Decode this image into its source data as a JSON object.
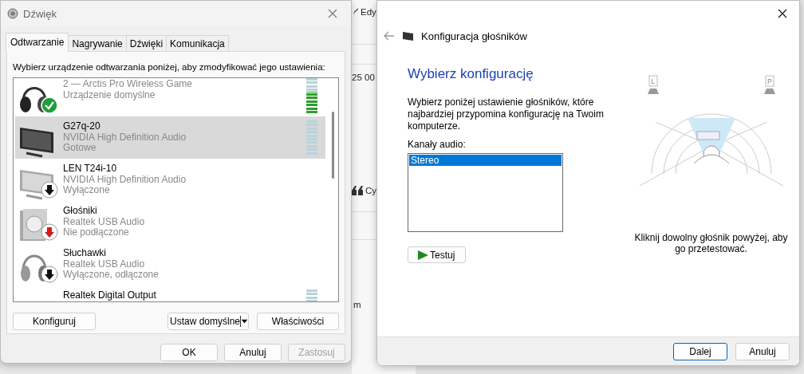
{
  "background_app": {
    "texts": [
      "Edy",
      "25 00",
      "Cy",
      "m"
    ]
  },
  "sound_window": {
    "title": "Dźwięk",
    "tabs": [
      {
        "label": "Odtwarzanie",
        "selected": true
      },
      {
        "label": "Nagrywanie",
        "selected": false
      },
      {
        "label": "Dźwięki",
        "selected": false
      },
      {
        "label": "Komunikacja",
        "selected": false
      }
    ],
    "instruction": "Wybierz urządzenie odtwarzania poniżej, aby zmodyfikować jego ustawienia:",
    "devices": [
      {
        "name": "2 — Arctis Pro Wireless Game",
        "driver": "Urządzenie domyślne",
        "kind": "headset",
        "is_default": true,
        "disabled": false,
        "unplugged": false,
        "selected": false,
        "dimmed": true,
        "meter": true,
        "level": 0.6
      },
      {
        "name": "G27q-20",
        "driver": "NVIDIA High Definition Audio",
        "status": "Gotowe",
        "kind": "monitor",
        "is_default": false,
        "disabled": false,
        "unplugged": false,
        "selected": true,
        "dimmed": false,
        "meter": true,
        "level": 0
      },
      {
        "name": "LEN T24i-10",
        "driver": "NVIDIA High Definition Audio",
        "status": "Wyłączone",
        "kind": "monitor-light",
        "is_default": false,
        "disabled": true,
        "unplugged": false,
        "selected": false,
        "dimmed": false,
        "meter": false
      },
      {
        "name": "Głośniki",
        "driver": "Realtek USB Audio",
        "status": "Nie podłączone",
        "kind": "speaker",
        "is_default": false,
        "disabled": false,
        "unplugged": true,
        "selected": false,
        "dimmed": false,
        "meter": false
      },
      {
        "name": "Słuchawki",
        "driver": "Realtek USB Audio",
        "status": "Wyłączone, odłączone",
        "kind": "headphones",
        "is_default": false,
        "disabled": true,
        "unplugged": false,
        "selected": false,
        "dimmed": false,
        "meter": false
      },
      {
        "name": "Realtek Digital Output",
        "kind": "receiver",
        "is_default": false,
        "disabled": false,
        "unplugged": false,
        "selected": false,
        "dimmed": false,
        "meter": true,
        "level": 0
      }
    ],
    "configure_button": "Konfiguruj",
    "set_default_button": "Ustaw domyślne",
    "properties_button": "Właściwości",
    "footer_buttons": [
      {
        "label": "OK",
        "disabled": false
      },
      {
        "label": "Anuluj",
        "disabled": false
      },
      {
        "label": "Zastosuj",
        "disabled": true
      }
    ]
  },
  "wizard_window": {
    "title": "Konfiguracja głośników",
    "heading": "Wybierz konfigurację",
    "description": "Wybierz poniżej ustawienie głośników, które najbardziej przypomina konfigurację na Twoim komputerze.",
    "channels_label": "Kanały audio:",
    "channels": [
      {
        "label": "Stereo",
        "selected": true
      }
    ],
    "test_button": "Testuj",
    "speaker_labels": [
      "L",
      "P"
    ],
    "hint": "Kliknij dowolny głośnik powyżej, aby go przetestować.",
    "buttons": [
      {
        "label": "Dalej",
        "default": true
      },
      {
        "label": "Anuluj",
        "default": false
      }
    ]
  }
}
